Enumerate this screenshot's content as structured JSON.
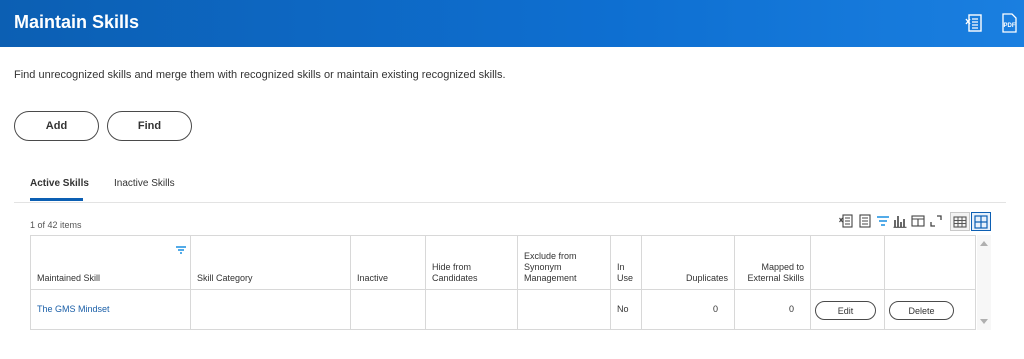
{
  "header": {
    "title": "Maintain Skills",
    "icons": [
      "export-to-excel-icon",
      "export-to-pdf-icon"
    ]
  },
  "description": "Find unrecognized skills and merge them with recognized skills or maintain existing recognized skills.",
  "actions": {
    "add_label": "Add",
    "find_label": "Find"
  },
  "tabs": [
    {
      "label": "Active Skills",
      "active": true
    },
    {
      "label": "Inactive Skills",
      "active": false
    }
  ],
  "grid": {
    "item_count": "1 of 42 items",
    "toolbar_icons": [
      "excel-export-icon",
      "related-actions-icon",
      "filter-icon",
      "chart-icon",
      "columns-icon",
      "fullscreen-icon",
      "table-view-icon",
      "grid-view-icon"
    ],
    "columns": {
      "maintained_skill": "Maintained Skill",
      "skill_category": "Skill Category",
      "inactive": "Inactive",
      "hide_1": "Hide from",
      "hide_2": "Candidates",
      "excl_1": "Exclude from",
      "excl_2": "Synonym",
      "excl_3": "Management",
      "inuse_1": "In",
      "inuse_2": "Use",
      "duplicates": "Duplicates",
      "mapped_1": "Mapped to",
      "mapped_2": "External Skills"
    },
    "rows": [
      {
        "maintained_skill": "The GMS Mindset",
        "skill_category": "",
        "inactive": "",
        "hide_from_candidates": "",
        "exclude_from_synonym": "",
        "in_use": "No",
        "duplicates": "0",
        "mapped_external": "0",
        "edit_label": "Edit",
        "delete_label": "Delete"
      }
    ]
  },
  "colors": {
    "header_blue": "#0c5fb3",
    "link_blue": "#1a5fa8"
  }
}
